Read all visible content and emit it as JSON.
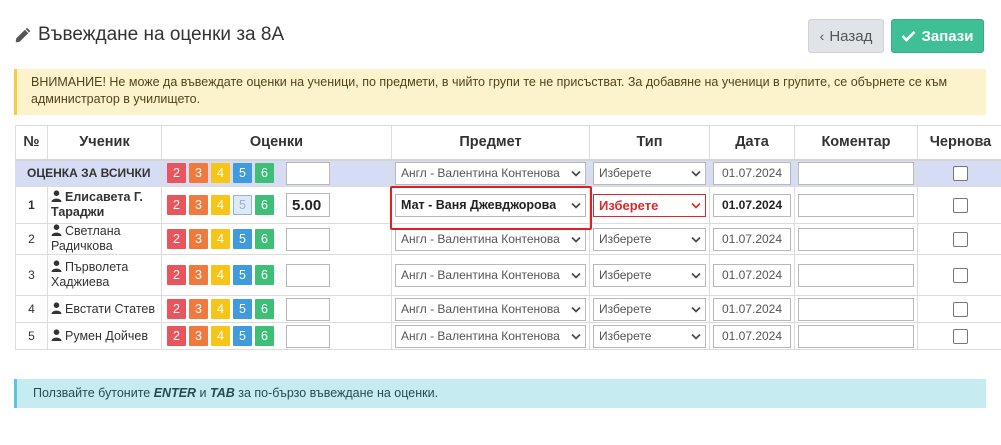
{
  "header": {
    "title": "Въвеждане на оценки за 8А",
    "back_label": "Назад",
    "save_label": "Запази"
  },
  "warning": "ВНИМАНИЕ! Не може да въвеждате оценки на ученици, по предмети, в чийто групи те не присъстват. За добавяне на ученици в групите, се обърнете се към администратор в училището.",
  "info": {
    "before": "Ползвайте бутоните ",
    "key1": "ENTER",
    "middle": " и ",
    "key2": "TAB",
    "after": " за по-бързо въвеждане на оценки."
  },
  "columns": [
    "№",
    "Ученик",
    "Оценки",
    "Предмет",
    "Тип",
    "Дата",
    "Коментар",
    "Чернова"
  ],
  "grade_buttons": [
    "2",
    "3",
    "4",
    "5",
    "6"
  ],
  "all_row": {
    "label": "ОЦЕНКА ЗА ВСИЧКИ",
    "grade": "",
    "subject": "Англ - Валентина Контенова",
    "type": "Изберете",
    "date": "01.07.2024",
    "comment": ""
  },
  "students": [
    {
      "num": "1",
      "name": "Елисавета Г. Тараджи",
      "grade": "5.00",
      "subject": "Мат - Ваня Джевджорова",
      "type": "Изберете",
      "date": "01.07.2024",
      "comment": ""
    },
    {
      "num": "2",
      "name": "Светлана Радичкова",
      "grade": "",
      "subject": "Англ - Валентина Контенова",
      "type": "Изберете",
      "date": "01.07.2024",
      "comment": ""
    },
    {
      "num": "3",
      "name": "Първолета Хаджиева",
      "grade": "",
      "subject": "Англ - Валентина Контенова",
      "type": "Изберете",
      "date": "01.07.2024",
      "comment": ""
    },
    {
      "num": "4",
      "name": "Евстати Статев",
      "grade": "",
      "subject": "Англ - Валентина Контенова",
      "type": "Изберете",
      "date": "01.07.2024",
      "comment": ""
    },
    {
      "num": "5",
      "name": "Румен Дойчев",
      "grade": "",
      "subject": "Англ - Валентина Контенова",
      "type": "Изберете",
      "date": "01.07.2024",
      "comment": ""
    }
  ],
  "colors": {
    "grade_2": "#e8555c",
    "grade_3": "#f07a3d",
    "grade_4": "#f7c418",
    "grade_5": "#3f9ade",
    "grade_6": "#3ebf76",
    "save": "#3ebf95",
    "error": "#d9292e",
    "all_row_bg": "#d7dcf5"
  },
  "icons": {
    "title": "pencil-icon",
    "back": "chevron-left-icon",
    "save": "check-icon",
    "student": "user-icon",
    "select": "chevron-down-icon"
  }
}
